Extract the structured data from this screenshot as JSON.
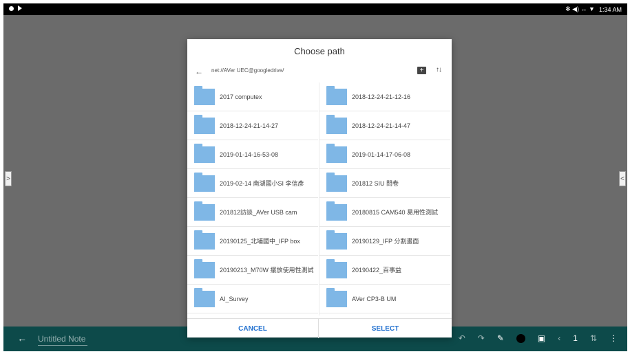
{
  "status_bar": {
    "time": "1:34 AM",
    "icons_right": "✻ ◀) ↔ ▼"
  },
  "bottom_bar": {
    "back_label": "←",
    "note_title": "Untitled Note",
    "page_number": "1"
  },
  "side_tabs": {
    "left": ">",
    "right": "<"
  },
  "dialog": {
    "title": "Choose path",
    "path": "net://AVer UEC@googledrive/",
    "back_label": "←",
    "new_folder_label": "+",
    "sort_label": "↑↓",
    "folders": [
      "2017 computex",
      "2018-12-24-21-12-16",
      "2018-12-24-21-14-27",
      "2018-12-24-21-14-47",
      "2019-01-14-16-53-08",
      "2019-01-14-17-06-08",
      "2019-02-14 南湖國小SI 李信彥",
      "201812 SIU 問卷",
      "201812訪談_AVer USB cam",
      "20180815 CAM540 易用性測試",
      "20190125_北埔國中_IFP box",
      "20190129_IFP 分割畫面",
      "20190213_M70W 擺放使用性測試",
      "20190422_百事益",
      "AI_Survey",
      "AVer CP3-B UM"
    ],
    "cancel_label": "CANCEL",
    "select_label": "SELECT"
  },
  "colors": {
    "accent": "#1f6fcf",
    "folder": "#7fb7e6",
    "bottom_bar": "#0d4a4a",
    "overlay": "#6b6b6b"
  }
}
